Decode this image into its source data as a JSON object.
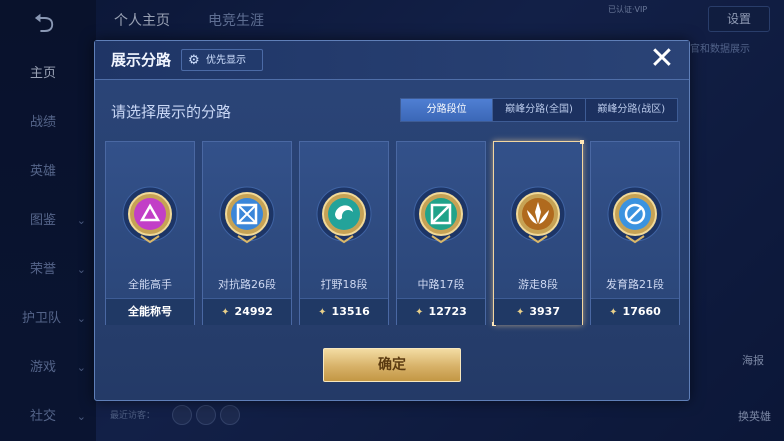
{
  "background": {
    "back_icon": "back-arrow-icon",
    "top_tabs": [
      "个人主页",
      "电竞生涯"
    ],
    "settings_label": "设置",
    "user_mini_text": "已认证·VIP",
    "right_hint_text": "官和数据展示",
    "nav_items": [
      {
        "label": "主页",
        "active": true,
        "chevron": false
      },
      {
        "label": "战绩",
        "active": false,
        "chevron": false
      },
      {
        "label": "英雄",
        "active": false,
        "chevron": false
      },
      {
        "label": "图鉴",
        "active": false,
        "chevron": true
      },
      {
        "label": "荣誉",
        "active": false,
        "chevron": true
      },
      {
        "label": "护卫队",
        "active": false,
        "chevron": true
      },
      {
        "label": "游戏",
        "active": false,
        "chevron": true
      },
      {
        "label": "社交",
        "active": false,
        "chevron": true
      }
    ],
    "recent_visitors_label": "最近访客：",
    "right_side_labels": [
      "海报",
      "换英雄"
    ]
  },
  "modal": {
    "title": "展示分路",
    "priority_label": "优先显示",
    "close_icon": "close-x-icon",
    "subtitle": "请选择展示的分路",
    "tabs": [
      {
        "label": "分路段位",
        "active": true
      },
      {
        "label": "巅峰分路(全国)",
        "active": false
      },
      {
        "label": "巅峰分路(战区)",
        "active": false
      }
    ],
    "lanes": [
      {
        "name": "全能高手",
        "footer": "全能称号",
        "points": "",
        "icon": "all-round-badge-icon",
        "color": "#c23fc7",
        "selected": false
      },
      {
        "name": "对抗路26段",
        "footer": "",
        "points": "24992",
        "icon": "clash-lane-badge-icon",
        "color": "#3a86d9",
        "selected": false
      },
      {
        "name": "打野18段",
        "footer": "",
        "points": "13516",
        "icon": "jungle-badge-icon",
        "color": "#23a39a",
        "selected": false
      },
      {
        "name": "中路17段",
        "footer": "",
        "points": "12723",
        "icon": "mid-lane-badge-icon",
        "color": "#21a38a",
        "selected": false
      },
      {
        "name": "游走8段",
        "footer": "",
        "points": "3937",
        "icon": "roam-badge-icon",
        "color": "#b06a1e",
        "selected": true
      },
      {
        "name": "发育路21段",
        "footer": "",
        "points": "17660",
        "icon": "farm-lane-badge-icon",
        "color": "#3b93e0",
        "selected": false
      }
    ],
    "confirm_label": "确定"
  }
}
